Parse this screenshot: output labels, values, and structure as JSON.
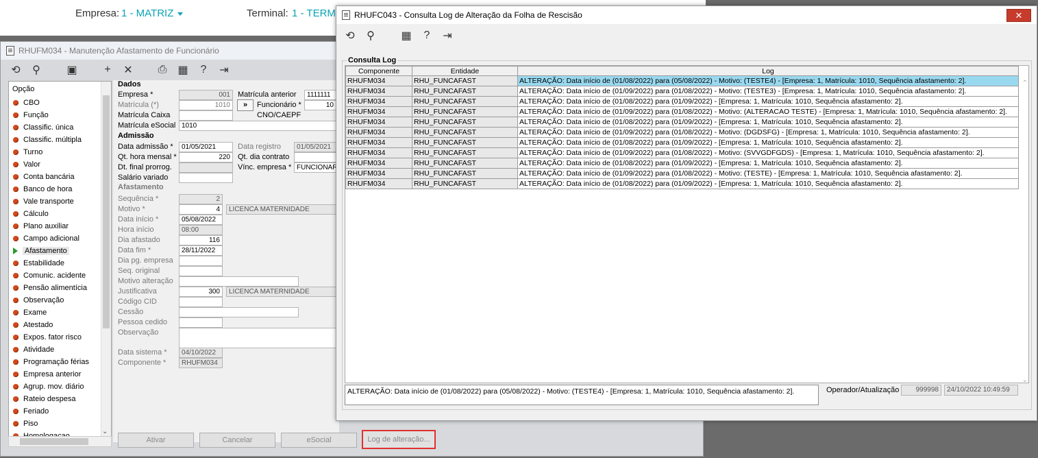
{
  "topbar": {
    "empresa_label": "Empresa:",
    "empresa_value": "1 - MATRIZ",
    "terminal_label": "Terminal:",
    "terminal_value": "1 - TERM"
  },
  "left_window": {
    "title": "RHUFM034 - Manutenção Afastamento de Funcionário",
    "menu_header": "Opção",
    "menu_items": [
      "CBO",
      "Função",
      "Classific. única",
      "Classific. múltipla",
      "Turno",
      "Valor",
      "Conta bancária",
      "Banco de hora",
      "Vale transporte",
      "Cálculo",
      "Plano auxiliar",
      "Campo adicional",
      "Afastamento",
      "Estabilidade",
      "Comunic. acidente",
      "Pensão alimentícia",
      "Observação",
      "Exame",
      "Atestado",
      "Expos. fator risco",
      "Atividade",
      "Programação férias",
      "Empresa anterior",
      "Agrup. mov. diário",
      "Rateio despesa",
      "Feriado",
      "Piso",
      "Homologacao"
    ],
    "dados": {
      "section": "Dados",
      "empresa_label": "Empresa *",
      "empresa_value": "001",
      "matricula_label": "Matrícula (*)",
      "matricula_value": "1010",
      "matricula_caixa_label": "Matrícula Caixa",
      "matricula_esocial_label": "Matrícula eSocial",
      "matricula_esocial_value": "1010",
      "matricula_anterior_label": "Matrícula anterior",
      "matricula_anterior_value": "1111111",
      "funcionario_label": "Funcionário *",
      "funcionario_value": "10",
      "funcionario_btn": "»",
      "cno_label": "CNO/CAEPF"
    },
    "admissao": {
      "section": "Admissão",
      "data_admissao_label": "Data admissão *",
      "data_admissao_value": "01/05/2021",
      "qt_hora_label": "Qt. hora mensal *",
      "qt_hora_value": "220",
      "dt_final_label": "Dt. final prorrog.",
      "salario_label": "Salário variado",
      "data_registro_label": "Data registro",
      "data_registro_value": "01/05/2021",
      "qt_dia_label": "Qt. dia contrato",
      "vinc_label": "Vínc. empresa *",
      "vinc_value": "FUNCIONAR"
    },
    "afastamento": {
      "section": "Afastamento",
      "sequencia_label": "Sequência *",
      "sequencia_value": "2",
      "motivo_label": "Motivo *",
      "motivo_value": "4",
      "motivo_desc": "LICENCA MATERNIDADE",
      "data_inicio_label": "Data início *",
      "data_inicio_value": "05/08/2022",
      "hora_inicio_label": "Hora início",
      "hora_inicio_value": "08:00",
      "dia_afastado_label": "Dia afastado",
      "dia_afastado_value": "116",
      "data_fim_label": "Data fim *",
      "data_fim_value": "28/11/2022",
      "dia_pg_label": "Dia pg. empresa",
      "seq_original_label": "Seq. original",
      "motivo_alt_label": "Motivo alteração",
      "justificativa_label": "Justificativa",
      "justificativa_value": "300",
      "justificativa_desc": "LICENCA MATERNIDADE",
      "codigo_cid_label": "Código CID",
      "cessao_label": "Cessão",
      "pessoa_cedido_label": "Pessoa cedido",
      "observacao_label": "Observação",
      "data_sistema_label": "Data sistema *",
      "data_sistema_value": "04/10/2022",
      "componente_label": "Componente *",
      "componente_value": "RHUFM034"
    },
    "buttons": {
      "ativar": "Ativar",
      "cancelar": "Cancelar",
      "esocial": "eSocial",
      "log": "Log de alteração..."
    }
  },
  "right_window": {
    "title": "RHUFC043 - Consulta Log de Alteração da Folha de Rescisão",
    "group_label": "Consulta Log",
    "columns": [
      "Componente",
      "Entidade",
      "Log"
    ],
    "rows": [
      [
        "RHUFM034",
        "RHU_FUNCAFAST",
        "ALTERAÇÃO: Data início de (01/08/2022) para (05/08/2022) - Motivo: (TESTE4) - [Empresa: 1, Matrícula: 1010, Sequência afastamento: 2]."
      ],
      [
        "RHUFM034",
        "RHU_FUNCAFAST",
        "ALTERAÇÃO: Data início de (01/09/2022) para (01/08/2022) - Motivo: (TESTE3) - [Empresa: 1, Matrícula: 1010, Sequência afastamento: 2]."
      ],
      [
        "RHUFM034",
        "RHU_FUNCAFAST",
        "ALTERAÇÃO: Data início de (01/08/2022) para (01/09/2022)  - [Empresa: 1, Matrícula: 1010, Sequência afastamento: 2]."
      ],
      [
        "RHUFM034",
        "RHU_FUNCAFAST",
        "ALTERAÇÃO: Data início de (01/09/2022) para (01/08/2022) - Motivo: (ALTERACAO TESTE) - [Empresa: 1, Matrícula: 1010, Sequência afastamento: 2]."
      ],
      [
        "RHUFM034",
        "RHU_FUNCAFAST",
        "ALTERAÇÃO: Data início de (01/08/2022) para (01/09/2022)  - [Empresa: 1, Matrícula: 1010, Sequência afastamento: 2]."
      ],
      [
        "RHUFM034",
        "RHU_FUNCAFAST",
        "ALTERAÇÃO: Data início de (01/09/2022) para (01/08/2022) - Motivo: (DGDSFG) - [Empresa: 1, Matrícula: 1010, Sequência afastamento: 2]."
      ],
      [
        "RHUFM034",
        "RHU_FUNCAFAST",
        "ALTERAÇÃO: Data início de (01/08/2022) para (01/09/2022)  - [Empresa: 1, Matrícula: 1010, Sequência afastamento: 2]."
      ],
      [
        "RHUFM034",
        "RHU_FUNCAFAST",
        "ALTERAÇÃO: Data início de (01/09/2022) para (01/08/2022) - Motivo: (SVVGDFGDS) - [Empresa: 1, Matrícula: 1010, Sequência afastamento: 2]."
      ],
      [
        "RHUFM034",
        "RHU_FUNCAFAST",
        "ALTERAÇÃO: Data início de (01/08/2022) para (01/09/2022)  - [Empresa: 1, Matrícula: 1010, Sequência afastamento: 2]."
      ],
      [
        "RHUFM034",
        "RHU_FUNCAFAST",
        "ALTERAÇÃO: Data início de (01/09/2022) para (01/08/2022) - Motivo: (TESTE) - [Empresa: 1, Matrícula: 1010, Sequência afastamento: 2]."
      ],
      [
        "RHUFM034",
        "RHU_FUNCAFAST",
        "ALTERAÇÃO: Data início de (01/08/2022) para (01/09/2022)  - [Empresa: 1, Matrícula: 1010, Sequência afastamento: 2]."
      ]
    ],
    "detail_text": "ALTERAÇÃO: Data início de (01/08/2022) para (05/08/2022) - Motivo: (TESTE4) - [Empresa: 1, Matrícula: 1010, Sequência afastamento: 2].",
    "operador_label": "Operador/Atualização",
    "operador_value": "999998",
    "atualizacao_value": "24/10/2022 10:49:59"
  }
}
